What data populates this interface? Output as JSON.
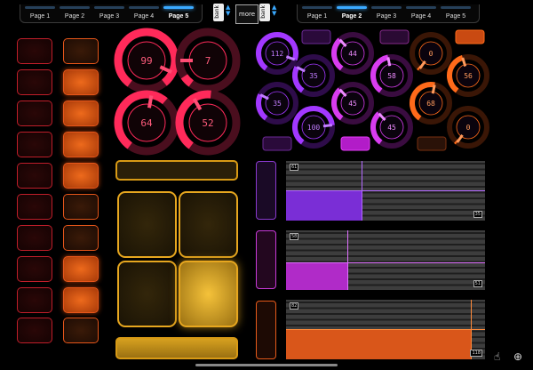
{
  "tabs_left": {
    "items": [
      {
        "label": "Page 1"
      },
      {
        "label": "Page 2"
      },
      {
        "label": "Page 3"
      },
      {
        "label": "Page 4"
      },
      {
        "label": "Page 5"
      }
    ],
    "active": "Page 5"
  },
  "tabs_right": {
    "items": [
      {
        "label": "Page 1"
      },
      {
        "label": "Page 2"
      },
      {
        "label": "Page 3"
      },
      {
        "label": "Page 4"
      },
      {
        "label": "Page 5"
      }
    ],
    "active": "Page 2"
  },
  "bank_label": "bank",
  "more_label": "more",
  "colors": {
    "red_accent": "#ff2a5a",
    "purple_accent": "#a238ff",
    "magenta_accent": "#d83cf0",
    "orange_accent": "#ff6a1a",
    "yellow_accent": "#e7a71f",
    "tab_active": "#3aa9ff"
  },
  "left_knobs": [
    {
      "value": "99",
      "level": 0.99
    },
    {
      "value": "7",
      "level": 0.07
    },
    {
      "value": "64",
      "level": 0.64
    },
    {
      "value": "52",
      "level": 0.52
    }
  ],
  "right_knobs": [
    {
      "value": "112",
      "level": 0.88,
      "color": "purple"
    },
    {
      "value": "35",
      "level": 0.28,
      "color": "purple"
    },
    {
      "value": "44",
      "level": 0.35,
      "color": "magenta"
    },
    {
      "value": "58",
      "level": 0.46,
      "color": "magenta"
    },
    {
      "value": "0",
      "level": 0.0,
      "color": "orange"
    },
    {
      "value": "56",
      "level": 0.44,
      "color": "orange"
    },
    {
      "value": "35",
      "level": 0.28,
      "color": "purple"
    },
    {
      "value": "45",
      "level": 0.35,
      "color": "magenta"
    },
    {
      "value": "68",
      "level": 0.54,
      "color": "orange"
    },
    {
      "value": "100",
      "level": 0.79,
      "color": "purple"
    },
    {
      "value": "45",
      "level": 0.35,
      "color": "magenta"
    },
    {
      "value": "0",
      "level": 0.0,
      "color": "orange"
    }
  ],
  "xy_panels": [
    {
      "top_tag": "61",
      "bottom_tag": "35",
      "x_level": 0.38,
      "y_level": 0.51
    },
    {
      "top_tag": "58",
      "bottom_tag": "51",
      "x_level": 0.31,
      "y_level": 0.46
    },
    {
      "top_tag": "82",
      "bottom_tag": "118",
      "x_level": 0.93,
      "y_level": 0.5
    }
  ],
  "pad_states": {
    "orange_column": [
      false,
      true,
      true,
      true,
      true,
      false,
      false,
      true,
      true,
      false
    ],
    "yellow_pads": [
      false,
      false,
      false,
      true
    ]
  }
}
